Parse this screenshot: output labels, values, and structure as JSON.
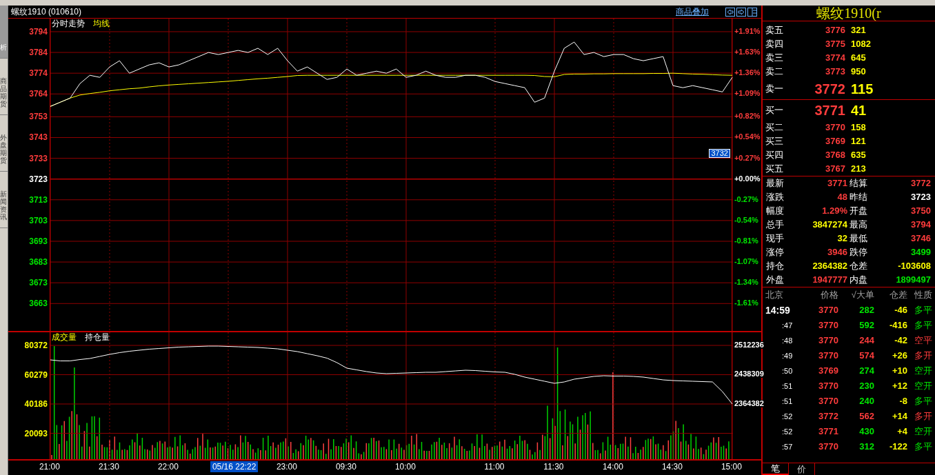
{
  "sidebar_tabs": [
    {
      "label": "析",
      "selected": true
    },
    {
      "label": "商品期货",
      "selected": false
    },
    {
      "label": "外盘期货",
      "selected": false
    },
    {
      "label": "新闻资讯",
      "selected": false
    }
  ],
  "chart_header": {
    "title": "螺纹1910 (010610)",
    "overlay_link": "商品叠加"
  },
  "price_panel": {
    "chart_data": {
      "type": "line",
      "grid": true,
      "ref_lines": [
        {
          "axis": "y",
          "value": 3723
        }
      ],
      "ylim": [
        3649.8,
        3800.3
      ],
      "series": [
        {
          "name": "分时走势",
          "color": "#ffffff",
          "values": [
            3758,
            3760,
            3762,
            3769,
            3773,
            3772,
            3777,
            3780,
            3774,
            3776,
            3778,
            3779,
            3777,
            3778,
            3780,
            3782,
            3784,
            3783,
            3784,
            3785,
            3784,
            3786,
            3783,
            3786,
            3780,
            3775,
            3777,
            3774,
            3771,
            3772,
            3776,
            3773,
            3774,
            3775,
            3774,
            3776,
            3772,
            3773,
            3775,
            3773,
            3772,
            3772,
            3773,
            3773,
            3772,
            3770,
            3769,
            3768,
            3767,
            3760,
            3762,
            3775,
            3786,
            3789,
            3783,
            3784,
            3782,
            3783,
            3783,
            3781,
            3780,
            3781,
            3782,
            3768,
            3767,
            3768,
            3767,
            3766,
            3765,
            3772
          ]
        },
        {
          "name": "均线",
          "color": "#ffff00",
          "values": [
            3758,
            3760,
            3762,
            3763.5,
            3764.2,
            3764.8,
            3765.5,
            3766,
            3766.5,
            3766.8,
            3767.4,
            3767.9,
            3768.3,
            3768.6,
            3768.9,
            3769.2,
            3769.5,
            3769.8,
            3770.1,
            3770.5,
            3770.9,
            3771.3,
            3771.6,
            3772,
            3772.4,
            3772.9,
            3773,
            3773,
            3773,
            3773,
            3773,
            3773,
            3773,
            3773,
            3773,
            3773,
            3773,
            3773,
            3773,
            3773,
            3773,
            3773,
            3773,
            3773,
            3773,
            3773,
            3773,
            3773,
            3773,
            3772.9,
            3772.4,
            3772.3,
            3773.4,
            3773.6,
            3773.6,
            3773.7,
            3773.7,
            3773.8,
            3773.8,
            3773.8,
            3773.8,
            3773.9,
            3773.9,
            3774,
            3773.8,
            3773.6,
            3773.5,
            3773.3,
            3773.1,
            3773
          ]
        }
      ],
      "yticks": [
        {
          "value": 3794,
          "label": "3794"
        },
        {
          "value": 3784,
          "label": "3784"
        },
        {
          "value": 3774,
          "label": "3774"
        },
        {
          "value": 3764,
          "label": "3764"
        },
        {
          "value": 3753,
          "label": "3753"
        },
        {
          "value": 3743,
          "label": "3743"
        },
        {
          "value": 3733,
          "label": "3733"
        },
        {
          "value": 3723,
          "label": "3723"
        },
        {
          "value": 3713,
          "label": "3713"
        },
        {
          "value": 3703,
          "label": "3703"
        },
        {
          "value": 3693,
          "label": "3693"
        },
        {
          "value": 3683,
          "label": "3683"
        },
        {
          "value": 3673,
          "label": "3673"
        },
        {
          "value": 3663,
          "label": "3663"
        }
      ]
    },
    "percent_ticks": [
      {
        "label": "+1.91%",
        "color": "#ff3c3c"
      },
      {
        "label": "+1.63%",
        "color": "#ff3c3c"
      },
      {
        "label": "+1.36%",
        "color": "#ff3c3c"
      },
      {
        "label": "+1.09%",
        "color": "#ff3c3c"
      },
      {
        "label": "+0.82%",
        "color": "#ff3c3c"
      },
      {
        "label": "+0.54%",
        "color": "#ff3c3c"
      },
      {
        "label": "+0.27%",
        "color": "#ff3c3c"
      },
      {
        "label": "+0.00%",
        "color": "#ffffff"
      },
      {
        "label": "-0.27%",
        "color": "#00e600"
      },
      {
        "label": "-0.54%",
        "color": "#00e600"
      },
      {
        "label": "-0.81%",
        "color": "#00e600"
      },
      {
        "label": "-1.07%",
        "color": "#00e600"
      },
      {
        "label": "-1.34%",
        "color": "#00e600"
      },
      {
        "label": "-1.61%",
        "color": "#00e600"
      }
    ],
    "crosshair_price": "3732"
  },
  "volume_panel": {
    "volume_legend": "成交量",
    "volume_ticks": [
      "80372",
      "60279",
      "40186",
      "20093"
    ],
    "chart_data": {
      "type": "line",
      "grid": true,
      "ylim": [
        2225219,
        2545287
      ],
      "categories": [
        "21:00",
        null,
        null,
        null,
        null,
        null,
        "21:30",
        null,
        null,
        null,
        null,
        null,
        "22:00",
        null,
        null,
        null,
        null,
        null,
        null,
        null,
        null,
        null,
        null,
        null,
        "23:00",
        null,
        null,
        null,
        null,
        null,
        "09:30",
        null,
        null,
        null,
        null,
        null,
        "10:00",
        null,
        null,
        null,
        null,
        null,
        null,
        null,
        null,
        "11:00",
        null,
        null,
        null,
        null,
        null,
        "11:30",
        null,
        null,
        null,
        null,
        null,
        "14:00",
        null,
        null,
        null,
        null,
        null,
        "14:30",
        null,
        null,
        null,
        null,
        null,
        "15:00"
      ],
      "series": [
        {
          "name": "持仓量",
          "color": "#ffffff",
          "values": [
            2475700,
            2473100,
            2473100,
            2476600,
            2479200,
            2484400,
            2489600,
            2494000,
            2497500,
            2500100,
            2502700,
            2504400,
            2506100,
            2507900,
            2508800,
            2509600,
            2510500,
            2510500,
            2509600,
            2508800,
            2507900,
            2507000,
            2505300,
            2503500,
            2500100,
            2496600,
            2491400,
            2486100,
            2480100,
            2468700,
            2454800,
            2450500,
            2446100,
            2442700,
            2440900,
            2441800,
            2442700,
            2443500,
            2444400,
            2444400,
            2446100,
            2447900,
            2449600,
            2448700,
            2447000,
            2445300,
            2444400,
            2439200,
            2432200,
            2427000,
            2421800,
            2416600,
            2420000,
            2427000,
            2430500,
            2434000,
            2435700,
            2434800,
            2434800,
            2434000,
            2432200,
            2428700,
            2425300,
            2423500,
            2422700,
            2421800,
            2420900,
            2420000,
            2395700,
            2364382
          ]
        }
      ],
      "yticks": [
        {
          "value": 2512236,
          "label": "2512236"
        },
        {
          "value": 2438309,
          "label": "2438309"
        },
        {
          "value": 2364382,
          "label": "2364382"
        }
      ]
    }
  },
  "time_axis": {
    "crosshair_time": "05/16 22:22"
  },
  "quote": {
    "title": "螺纹1910(r",
    "asks": [
      {
        "label": "卖五",
        "price": "3776",
        "volume": "321"
      },
      {
        "label": "卖四",
        "price": "3775",
        "volume": "1082"
      },
      {
        "label": "卖三",
        "price": "3774",
        "volume": "645"
      },
      {
        "label": "卖二",
        "price": "3773",
        "volume": "950"
      },
      {
        "label": "卖一",
        "price": "3772",
        "volume": "115"
      }
    ],
    "bids": [
      {
        "label": "买一",
        "price": "3771",
        "volume": "41"
      },
      {
        "label": "买二",
        "price": "3770",
        "volume": "158"
      },
      {
        "label": "买三",
        "price": "3769",
        "volume": "121"
      },
      {
        "label": "买四",
        "price": "3768",
        "volume": "635"
      },
      {
        "label": "买五",
        "price": "3767",
        "volume": "213"
      }
    ],
    "stats": [
      {
        "label": "最新",
        "value": "3771",
        "color": "#ff3c3c"
      },
      {
        "label": "结算",
        "value": "3772",
        "color": "#ff3c3c"
      },
      {
        "label": "涨跌",
        "value": "48",
        "color": "#ff3c3c"
      },
      {
        "label": "昨结",
        "value": "3723",
        "color": "#ffffff"
      },
      {
        "label": "幅度",
        "value": "1.29%",
        "color": "#ff3c3c"
      },
      {
        "label": "开盘",
        "value": "3750",
        "color": "#ff3c3c"
      },
      {
        "label": "总手",
        "value": "3847274",
        "color": "#ffff00"
      },
      {
        "label": "最高",
        "value": "3794",
        "color": "#ff3c3c"
      },
      {
        "label": "现手",
        "value": "32",
        "color": "#ffff00"
      },
      {
        "label": "最低",
        "value": "3746",
        "color": "#ff3c3c"
      },
      {
        "label": "涨停",
        "value": "3946",
        "color": "#ff3c3c"
      },
      {
        "label": "跌停",
        "value": "3499",
        "color": "#00e600"
      },
      {
        "label": "持仓",
        "value": "2364382",
        "color": "#ffff00"
      },
      {
        "label": "仓差",
        "value": "-103608",
        "color": "#ffff00"
      },
      {
        "label": "外盘",
        "value": "1947777",
        "color": "#ff3c3c"
      },
      {
        "label": "内盘",
        "value": "1899497",
        "color": "#00e600"
      }
    ],
    "trades_header": [
      "北京",
      "价格",
      "√大单",
      "仓差",
      "性质"
    ],
    "trades": [
      {
        "time": "14:59",
        "price": "3770",
        "volume": "282",
        "oi_change": "-46",
        "nature": "多平",
        "color": "#00e600"
      },
      {
        "time": ":47",
        "price": "3770",
        "volume": "592",
        "oi_change": "-416",
        "nature": "多平",
        "color": "#00e600"
      },
      {
        "time": ":48",
        "price": "3770",
        "volume": "244",
        "oi_change": "-42",
        "nature": "空平",
        "color": "#ff3c3c"
      },
      {
        "time": ":49",
        "price": "3770",
        "volume": "574",
        "oi_change": "+26",
        "nature": "多开",
        "color": "#ff3c3c"
      },
      {
        "time": ":50",
        "price": "3769",
        "volume": "274",
        "oi_change": "+10",
        "nature": "空开",
        "color": "#00e600"
      },
      {
        "time": ":51",
        "price": "3770",
        "volume": "230",
        "oi_change": "+12",
        "nature": "空开",
        "color": "#00e600"
      },
      {
        "time": ":51",
        "price": "3770",
        "volume": "240",
        "oi_change": "-8",
        "nature": "多平",
        "color": "#00e600"
      },
      {
        "time": ":52",
        "price": "3772",
        "volume": "562",
        "oi_change": "+14",
        "nature": "多开",
        "color": "#ff3c3c"
      },
      {
        "time": ":52",
        "price": "3771",
        "volume": "430",
        "oi_change": "+4",
        "nature": "空开",
        "color": "#00e600"
      },
      {
        "time": ":57",
        "price": "3770",
        "volume": "312",
        "oi_change": "-122",
        "nature": "多平",
        "color": "#00e600"
      }
    ],
    "tabs": [
      {
        "label": "笔",
        "selected": true
      },
      {
        "label": "价",
        "selected": false
      }
    ]
  }
}
